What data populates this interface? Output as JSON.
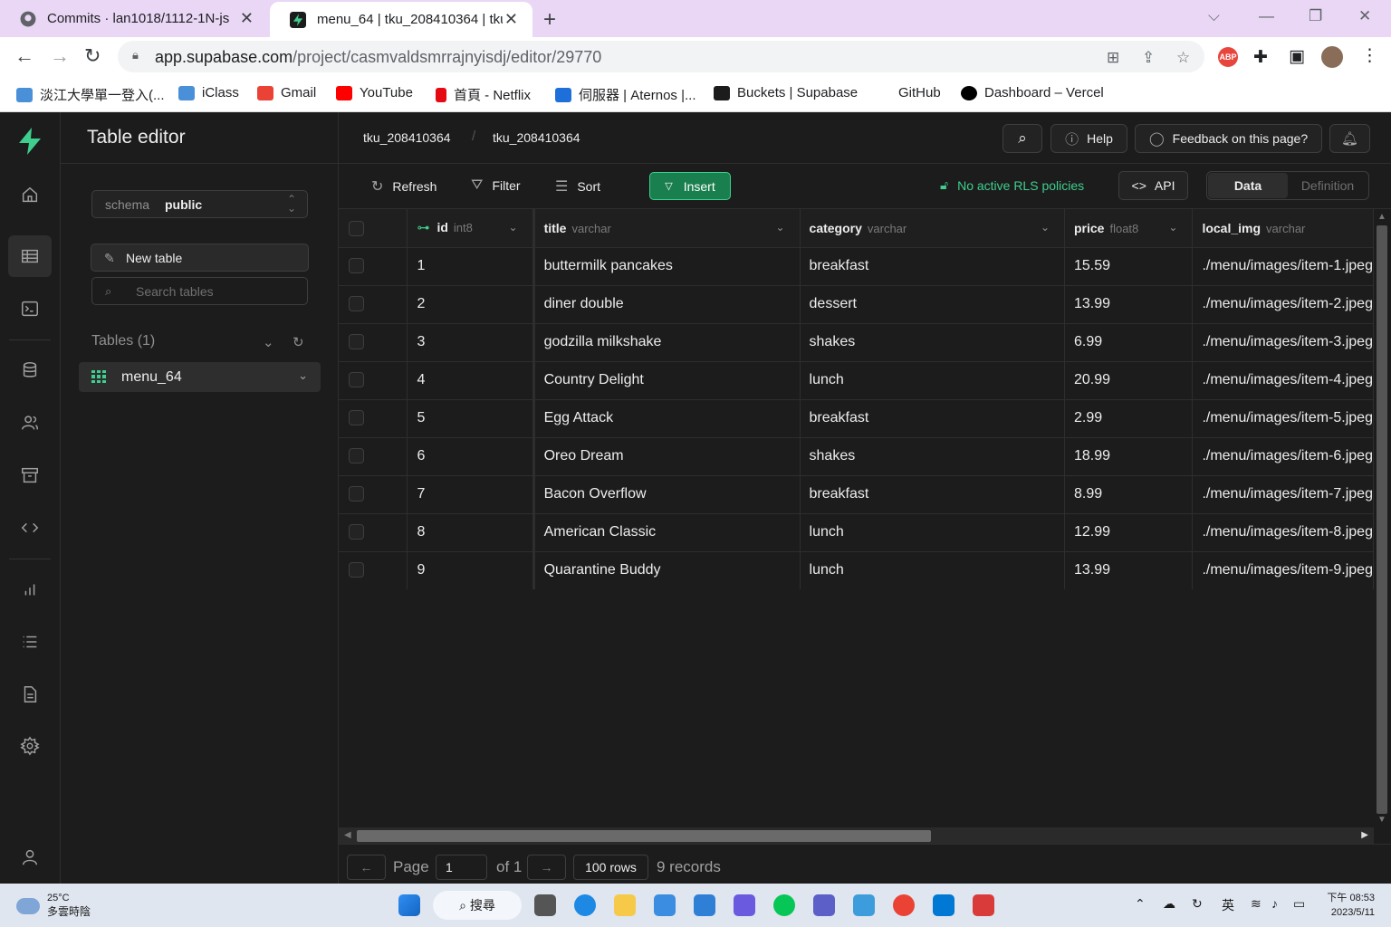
{
  "browser": {
    "tabs": [
      {
        "title": "Commits · lan1018/1112-1N-js",
        "active": false
      },
      {
        "title": "menu_64 | tku_208410364 | tku",
        "active": true
      }
    ],
    "url_host": "app.supabase.com",
    "url_path": "/project/casmvaldsmrrajnyisdj/editor/29770",
    "bookmarks": [
      {
        "label": "淡江大學單一登入(...",
        "icon": "tku-icon",
        "color": "#4a90d9"
      },
      {
        "label": "iClass",
        "icon": "iclass-icon",
        "color": "#4a90d9"
      },
      {
        "label": "Gmail",
        "icon": "gmail-icon",
        "color": "#ea4335"
      },
      {
        "label": "YouTube",
        "icon": "youtube-icon",
        "color": "#ff0000"
      },
      {
        "label": "首頁 - Netflix",
        "icon": "netflix-icon",
        "color": "#e50914"
      },
      {
        "label": "伺服器 | Aternos |...",
        "icon": "aternos-icon",
        "color": "#1e6fd9"
      },
      {
        "label": "Buckets | Supabase",
        "icon": "supabase-icon",
        "color": "#1c1c1c"
      },
      {
        "label": "GitHub",
        "icon": "github-icon",
        "color": "#ffffff"
      },
      {
        "label": "Dashboard – Vercel",
        "icon": "vercel-icon",
        "color": "#000000"
      }
    ]
  },
  "sidebar": {
    "title": "Table editor",
    "schema_label": "schema",
    "schema_value": "public",
    "new_table_label": "New table",
    "search_placeholder": "Search tables",
    "tables_heading": "Tables (1)",
    "tables": [
      {
        "name": "menu_64"
      }
    ]
  },
  "header": {
    "breadcrumb": [
      "tku_208410364",
      "tku_208410364"
    ],
    "help_label": "Help",
    "feedback_label": "Feedback on this page?"
  },
  "actions": {
    "refresh": "Refresh",
    "filter": "Filter",
    "sort": "Sort",
    "insert": "Insert",
    "rls": "No active RLS policies",
    "api": "API",
    "view_data": "Data",
    "view_definition": "Definition"
  },
  "grid": {
    "columns": [
      {
        "name": "id",
        "type": "int8",
        "primary_key": true
      },
      {
        "name": "title",
        "type": "varchar"
      },
      {
        "name": "category",
        "type": "varchar"
      },
      {
        "name": "price",
        "type": "float8"
      },
      {
        "name": "local_img",
        "type": "varchar"
      }
    ],
    "rows": [
      [
        "1",
        "buttermilk pancakes",
        "breakfast",
        "15.59",
        "./menu/images/item-1.jpeg"
      ],
      [
        "2",
        "diner double",
        "dessert",
        "13.99",
        "./menu/images/item-2.jpeg"
      ],
      [
        "3",
        "godzilla milkshake",
        "shakes",
        "6.99",
        "./menu/images/item-3.jpeg"
      ],
      [
        "4",
        "Country Delight",
        "lunch",
        "20.99",
        "./menu/images/item-4.jpeg"
      ],
      [
        "5",
        "Egg Attack",
        "breakfast",
        "2.99",
        "./menu/images/item-5.jpeg"
      ],
      [
        "6",
        "Oreo Dream",
        "shakes",
        "18.99",
        "./menu/images/item-6.jpeg"
      ],
      [
        "7",
        "Bacon Overflow",
        "breakfast",
        "8.99",
        "./menu/images/item-7.jpeg"
      ],
      [
        "8",
        "American Classic",
        "lunch",
        "12.99",
        "./menu/images/item-8.jpeg"
      ],
      [
        "9",
        "Quarantine Buddy",
        "lunch",
        "13.99",
        "./menu/images/item-9.jpeg"
      ]
    ]
  },
  "pagination": {
    "page_label": "Page",
    "page_value": "1",
    "of_label": "of 1",
    "rows_label": "100 rows",
    "records_label": "9 records"
  },
  "taskbar": {
    "temperature": "25°C",
    "weather": "多雲時陰",
    "search_label": "搜尋",
    "ime": "英",
    "time": "下午 08:53",
    "date": "2023/5/11"
  },
  "colors": {
    "accent": "#3ecf8e",
    "background": "#1c1c1c",
    "border": "#2e2e2e"
  }
}
